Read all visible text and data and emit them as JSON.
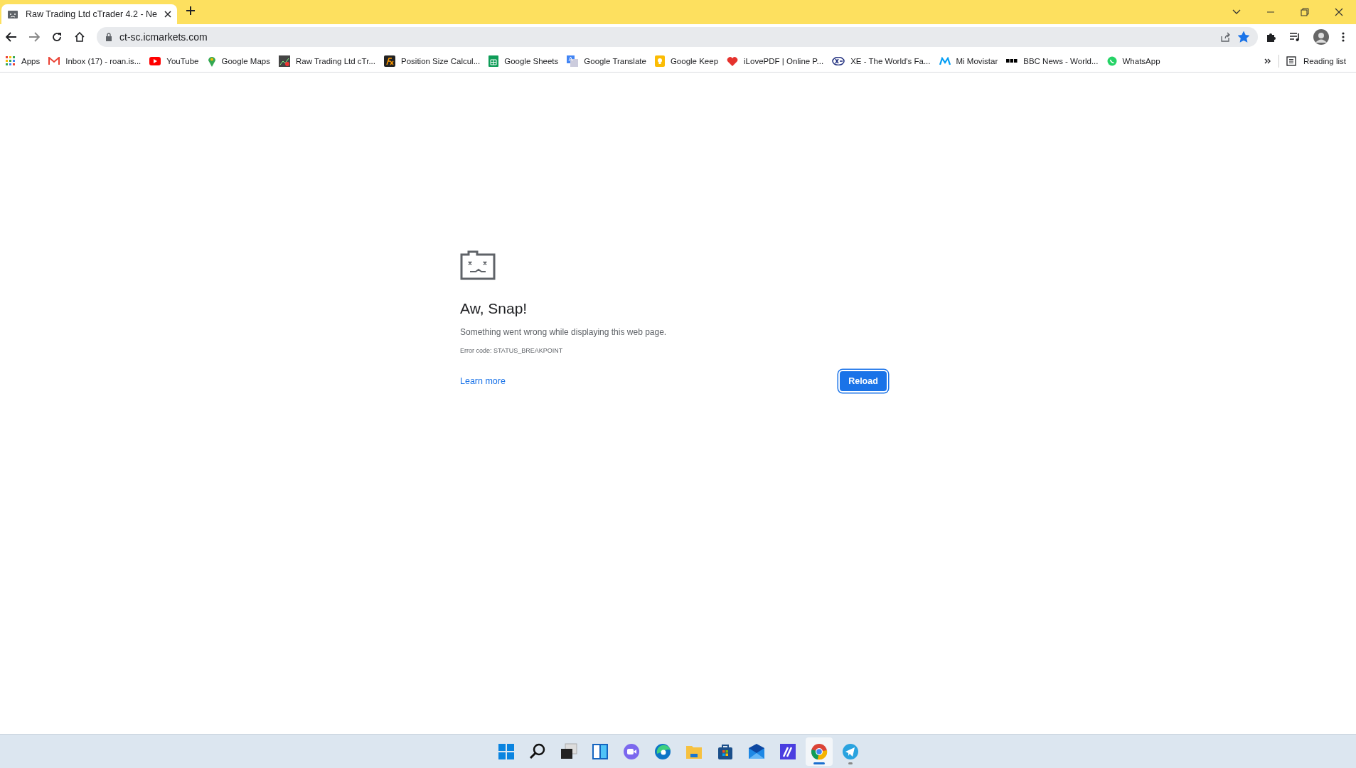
{
  "tabs": [
    {
      "title": "Raw Trading Ltd cTrader 4.2 - Ne",
      "selected": true
    }
  ],
  "toolbar": {
    "address": "ct-sc.icmarkets.com",
    "bookmarked": true
  },
  "bookmarks": [
    {
      "kind": "apps",
      "label": "Apps"
    },
    {
      "kind": "gmail",
      "label": "Inbox (17) - roan.is..."
    },
    {
      "kind": "youtube",
      "label": "YouTube"
    },
    {
      "kind": "maps",
      "label": "Google Maps"
    },
    {
      "kind": "chart",
      "label": "Raw Trading Ltd cTr..."
    },
    {
      "kind": "fx",
      "label": "Position Size Calcul..."
    },
    {
      "kind": "sheets",
      "label": "Google Sheets"
    },
    {
      "kind": "translate",
      "label": "Google Translate"
    },
    {
      "kind": "keep",
      "label": "Google Keep"
    },
    {
      "kind": "heart",
      "label": "iLovePDF | Online P..."
    },
    {
      "kind": "xe",
      "label": "XE - The World's Fa..."
    },
    {
      "kind": "movistar",
      "label": "Mi Movistar"
    },
    {
      "kind": "bbc",
      "label": "BBC News - World..."
    },
    {
      "kind": "whatsapp",
      "label": "WhatsApp"
    }
  ],
  "reading_list": "Reading list",
  "error": {
    "heading": "Aw, Snap!",
    "message": "Something went wrong while displaying this web page.",
    "code": "Error code: STATUS_BREAKPOINT",
    "link": "Learn more",
    "button": "Reload"
  },
  "taskbar": [
    {
      "kind": "start",
      "selected": false,
      "running": false
    },
    {
      "kind": "search",
      "selected": false,
      "running": false
    },
    {
      "kind": "taskview",
      "selected": false,
      "running": false
    },
    {
      "kind": "widgets",
      "selected": false,
      "running": false
    },
    {
      "kind": "chat",
      "selected": false,
      "running": false
    },
    {
      "kind": "edge",
      "selected": false,
      "running": false
    },
    {
      "kind": "files",
      "selected": false,
      "running": false
    },
    {
      "kind": "store",
      "selected": false,
      "running": false
    },
    {
      "kind": "mail",
      "selected": false,
      "running": false
    },
    {
      "kind": "editor",
      "selected": false,
      "running": false
    },
    {
      "kind": "chrome",
      "selected": true,
      "running": true
    },
    {
      "kind": "telegram",
      "selected": false,
      "running": true
    }
  ]
}
